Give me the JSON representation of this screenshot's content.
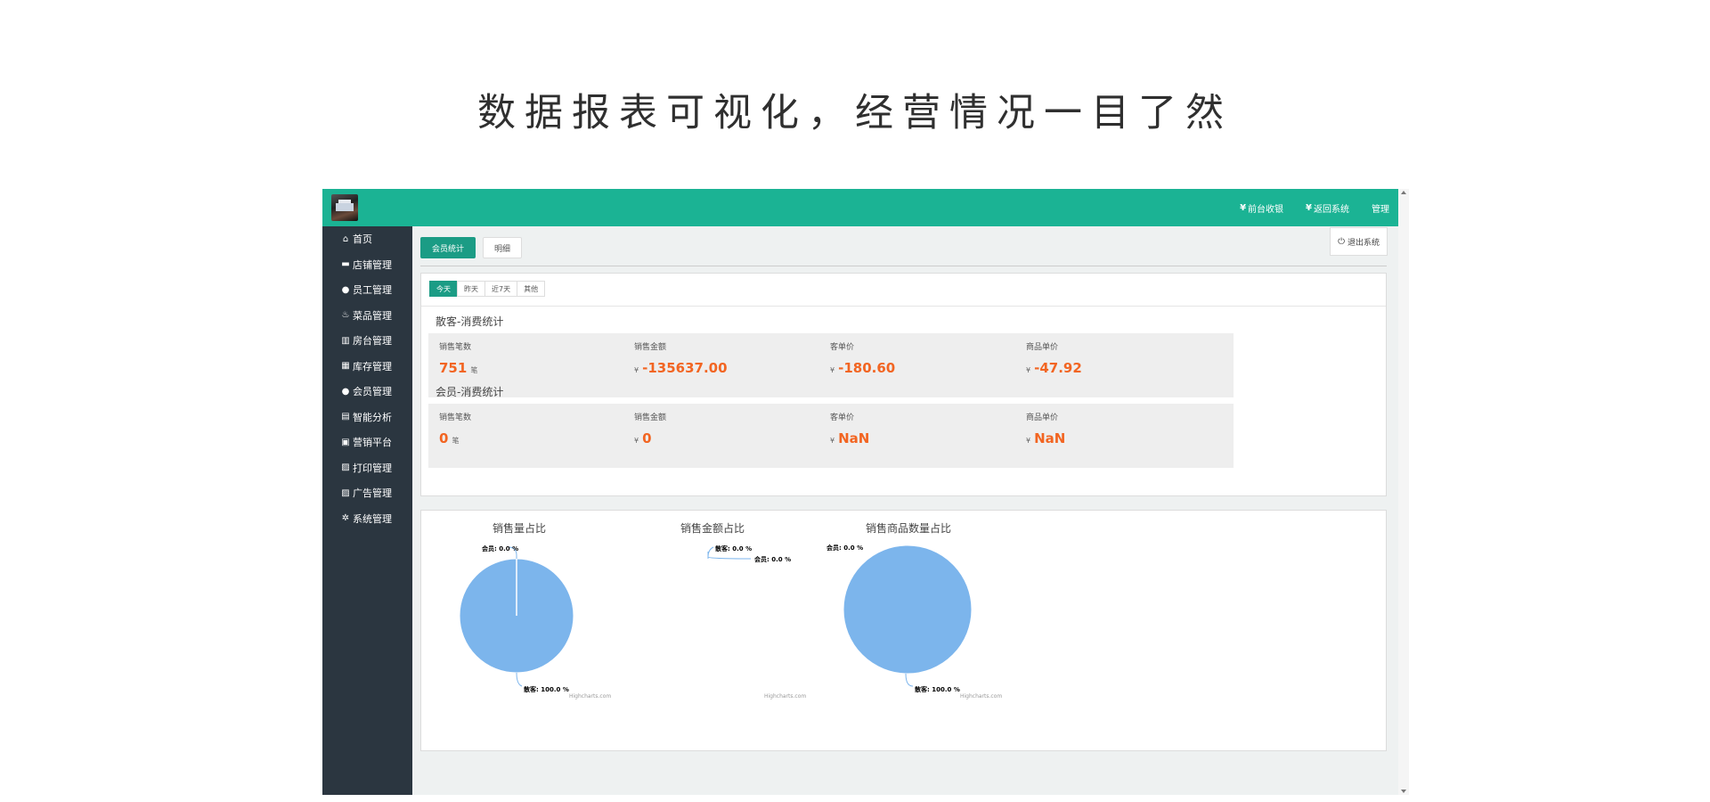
{
  "headline": "数据报表可视化，经营情况一目了然",
  "topbar": {
    "links": [
      {
        "label": "前台收银",
        "icon": "yen-icon"
      },
      {
        "label": "返回系统",
        "icon": "yen-icon"
      },
      {
        "label": "管理",
        "icon": ""
      }
    ]
  },
  "sidebar": {
    "items": [
      {
        "label": "首页",
        "icon": "home-icon",
        "glyph": "⌂"
      },
      {
        "label": "店铺管理",
        "icon": "briefcase-icon",
        "glyph": "▬"
      },
      {
        "label": "员工管理",
        "icon": "user-icon",
        "glyph": "●"
      },
      {
        "label": "菜品管理",
        "icon": "fire-icon",
        "glyph": "♨"
      },
      {
        "label": "房台管理",
        "icon": "bar-chart-icon",
        "glyph": "▥"
      },
      {
        "label": "库存管理",
        "icon": "grid-icon",
        "glyph": "▦"
      },
      {
        "label": "会员管理",
        "icon": "user-icon",
        "glyph": "●"
      },
      {
        "label": "智能分析",
        "icon": "chart-icon",
        "glyph": "▤"
      },
      {
        "label": "营销平台",
        "icon": "apps-icon",
        "glyph": "▣"
      },
      {
        "label": "打印管理",
        "icon": "printer-icon",
        "glyph": "▨"
      },
      {
        "label": "广告管理",
        "icon": "printer-icon",
        "glyph": "▨"
      },
      {
        "label": "系统管理",
        "icon": "gear-icon",
        "glyph": "✲"
      }
    ]
  },
  "tabs": {
    "member_stats": "会员统计",
    "detail": "明细"
  },
  "logout": "退出系统",
  "ranges": {
    "today": "今天",
    "yesterday": "昨天",
    "last7": "近7天",
    "other": "其他"
  },
  "guest_section": {
    "title": "散客-消费统计",
    "cards": [
      {
        "label": "销售笔数",
        "value": "751",
        "unit": "笔",
        "currency": ""
      },
      {
        "label": "销售金额",
        "value": "-135637.00",
        "unit": "",
        "currency": "¥"
      },
      {
        "label": "客单价",
        "value": "-180.60",
        "unit": "",
        "currency": "¥"
      },
      {
        "label": "商品单价",
        "value": "-47.92",
        "unit": "",
        "currency": "¥"
      }
    ]
  },
  "member_section": {
    "title": "会员-消费统计",
    "cards": [
      {
        "label": "销售笔数",
        "value": "0",
        "unit": "笔",
        "currency": ""
      },
      {
        "label": "销售金额",
        "value": "0",
        "unit": "",
        "currency": "¥"
      },
      {
        "label": "客单价",
        "value": "NaN",
        "unit": "",
        "currency": "¥"
      },
      {
        "label": "商品单价",
        "value": "NaN",
        "unit": "",
        "currency": "¥"
      }
    ]
  },
  "chart_data": [
    {
      "type": "pie",
      "title": "销售量占比",
      "slices": [
        {
          "name": "会员",
          "value": 0.0,
          "label": "会员: 0.0 %"
        },
        {
          "name": "散客",
          "value": 100.0,
          "label": "散客: 100.0 %"
        }
      ],
      "credit": "Highcharts.com"
    },
    {
      "type": "pie",
      "title": "销售金额占比",
      "slices": [
        {
          "name": "散客",
          "value": 0.0,
          "label": "散客: 0.0 %"
        },
        {
          "name": "会员",
          "value": 0.0,
          "label": "会员: 0.0 %"
        }
      ],
      "credit": "Highcharts.com"
    },
    {
      "type": "pie",
      "title": "销售商品数量占比",
      "slices": [
        {
          "name": "会员",
          "value": 0.0,
          "label": "会员: 0.0 %"
        },
        {
          "name": "散客",
          "value": 100.0,
          "label": "散客: 100.0 %"
        }
      ],
      "credit": "Highcharts.com"
    }
  ],
  "colors": {
    "accent": "#1bb394",
    "sidebar": "#2b3640",
    "value": "#f26522",
    "pie": "#7cb5ec"
  }
}
